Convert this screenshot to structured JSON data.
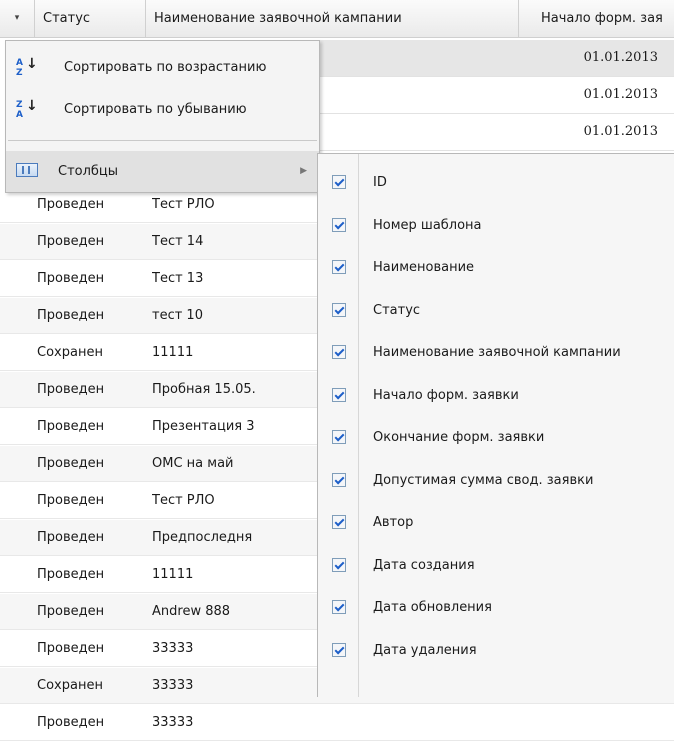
{
  "header": {
    "sort_indicator": "▾",
    "columns": [
      "Статус",
      "Наименование заявочной кампании",
      "Начало форм. зая"
    ]
  },
  "top_rows": [
    "01.01.2013",
    "01.01.2013",
    "01.01.2013"
  ],
  "rows": [
    {
      "status": "Проведен",
      "name": "Тест РЛО"
    },
    {
      "status": "Проведен",
      "name": "Тест 14"
    },
    {
      "status": "Проведен",
      "name": "Тест 13"
    },
    {
      "status": "Проведен",
      "name": "тест 10"
    },
    {
      "status": "Сохранен",
      "name": "11111"
    },
    {
      "status": "Проведен",
      "name": "Пробная 15.05."
    },
    {
      "status": "Проведен",
      "name": "Презентация 3"
    },
    {
      "status": "Проведен",
      "name": "ОМС на май"
    },
    {
      "status": "Проведен",
      "name": "Тест РЛО"
    },
    {
      "status": "Проведен",
      "name": "Предпоследня"
    },
    {
      "status": "Проведен",
      "name": "11111"
    },
    {
      "status": "Проведен",
      "name": "Andrew 888"
    },
    {
      "status": "Проведен",
      "name": "33333"
    },
    {
      "status": "Сохранен",
      "name": "33333"
    },
    {
      "status": "Проведен",
      "name": "33333"
    }
  ],
  "context_menu": {
    "sort_asc": "Сортировать по возрастанию",
    "sort_desc": "Сортировать по убыванию",
    "columns": "Столбцы",
    "sort_asc_glyph": "A Z",
    "sort_desc_glyph": "Z A",
    "submenu_arrow": "▶"
  },
  "columns_submenu": [
    {
      "label": "ID",
      "checked": true
    },
    {
      "label": "Номер шаблона",
      "checked": true
    },
    {
      "label": "Наименование",
      "checked": true
    },
    {
      "label": "Статус",
      "checked": true
    },
    {
      "label": "Наименование заявочной кампании",
      "checked": true
    },
    {
      "label": "Начало форм. заявки",
      "checked": true
    },
    {
      "label": "Окончание форм. заявки",
      "checked": true
    },
    {
      "label": "Допустимая сумма свод. заявки",
      "checked": true
    },
    {
      "label": "Автор",
      "checked": true
    },
    {
      "label": "Дата создания",
      "checked": true
    },
    {
      "label": "Дата обновления",
      "checked": true
    },
    {
      "label": "Дата удаления",
      "checked": true
    }
  ],
  "colors": {
    "checkmark": "#1d5fc9",
    "menu_bg": "#f4f4f4",
    "menu_hover": "#e1e1e1",
    "column_icon": "#4b7bbd"
  }
}
